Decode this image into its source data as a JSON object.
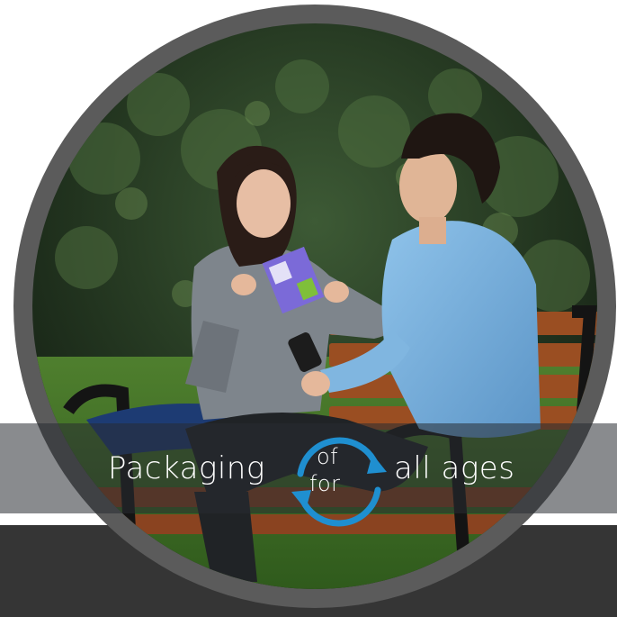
{
  "slogan": {
    "left": "Packaging",
    "of": "of",
    "for": "for",
    "right": "all ages"
  },
  "colors": {
    "ring": "#5b5b5b",
    "bottom_band": "#353535",
    "arrow_blue": "#1f8fd0",
    "text": "#ffffff"
  },
  "icons": {
    "cycle": "circular-arrows-icon"
  }
}
